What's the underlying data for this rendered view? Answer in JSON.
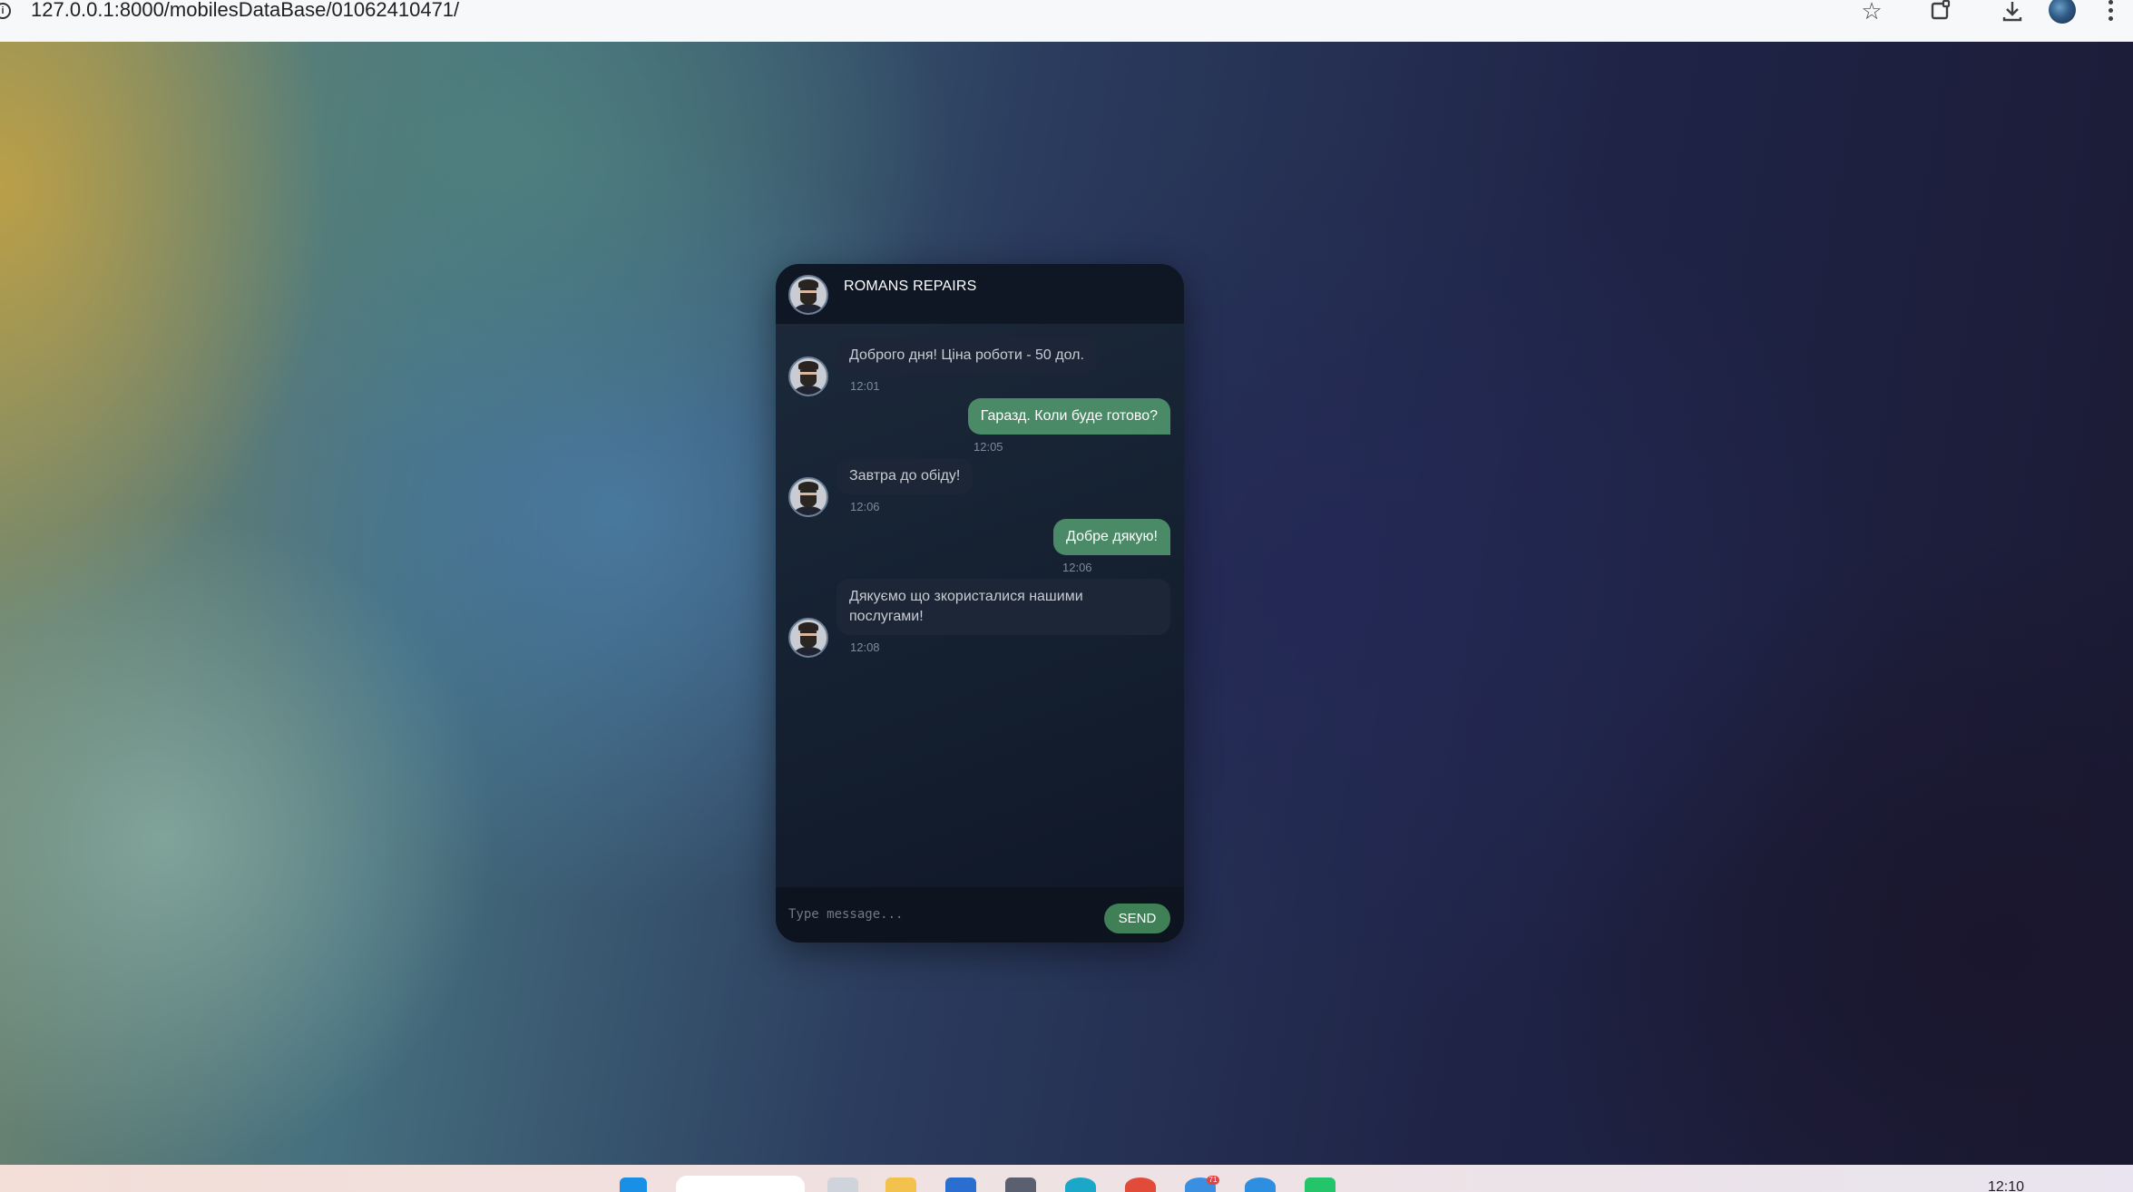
{
  "browser": {
    "url": "127.0.0.1:8000/mobilesDataBase/01062410471/",
    "icons": [
      "info-icon",
      "star-icon",
      "extensions-icon",
      "download-icon",
      "profile-avatar",
      "more-menu-icon"
    ]
  },
  "chat": {
    "title": "ROMANS REPAIRS",
    "messages": [
      {
        "direction": "in",
        "text": "Доброго дня! Ціна роботи - 50 дол.",
        "time": "12:01"
      },
      {
        "direction": "out",
        "text": "Гаразд. Коли буде готово?",
        "time": "12:05"
      },
      {
        "direction": "in",
        "text": "Завтра до обіду!",
        "time": "12:06"
      },
      {
        "direction": "out",
        "text": "Добре дякую!",
        "time": "12:06"
      },
      {
        "direction": "in",
        "text": "Дякуємо що зкористалися нашими послугами!",
        "time": "12:08"
      }
    ],
    "input_placeholder": "Type message...",
    "send_label": "SEND"
  },
  "taskbar": {
    "clock": "12:10",
    "badge": "71"
  },
  "colors": {
    "outgoing_bubble": "#4a8a67",
    "incoming_bubble": "#1c2636",
    "send_button": "#3f8056"
  }
}
